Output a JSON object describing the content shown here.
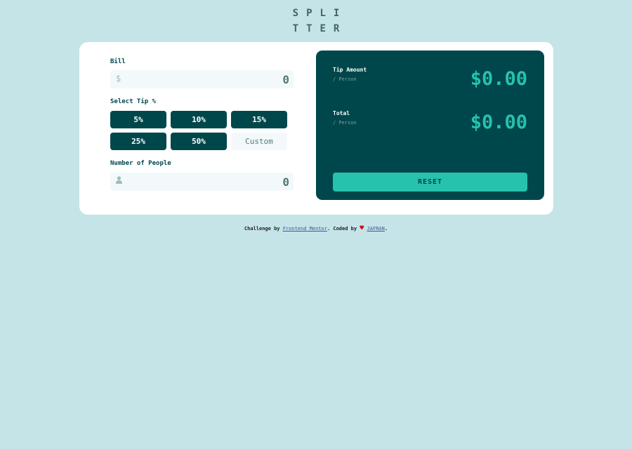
{
  "logo": {
    "line1": "SPLI",
    "line2": "TTER"
  },
  "bill": {
    "label": "Bill",
    "prefix": "$",
    "placeholder": "0"
  },
  "tip": {
    "label": "Select Tip %",
    "options": [
      "5%",
      "10%",
      "15%",
      "25%",
      "50%"
    ],
    "custom_placeholder": "Custom"
  },
  "people": {
    "label": "Number of People",
    "placeholder": "0"
  },
  "results": {
    "tip_label": "Tip Amount",
    "tip_sub": "/ Person",
    "tip_value": "$0.00",
    "total_label": "Total",
    "total_sub": "/ Person",
    "total_value": "$0.00",
    "reset_label": "RESET"
  },
  "footer": {
    "text1": "Challenge by ",
    "link1": "Frontend Mentor",
    "text2": ". Coded by ",
    "heart": "♥",
    "link2": "JAFRAN",
    "text3": "."
  },
  "colors": {
    "background": "#c5e4e7",
    "dark_cyan": "#00474b",
    "accent": "#26c2ad",
    "input_bg": "#f3f9fa"
  }
}
